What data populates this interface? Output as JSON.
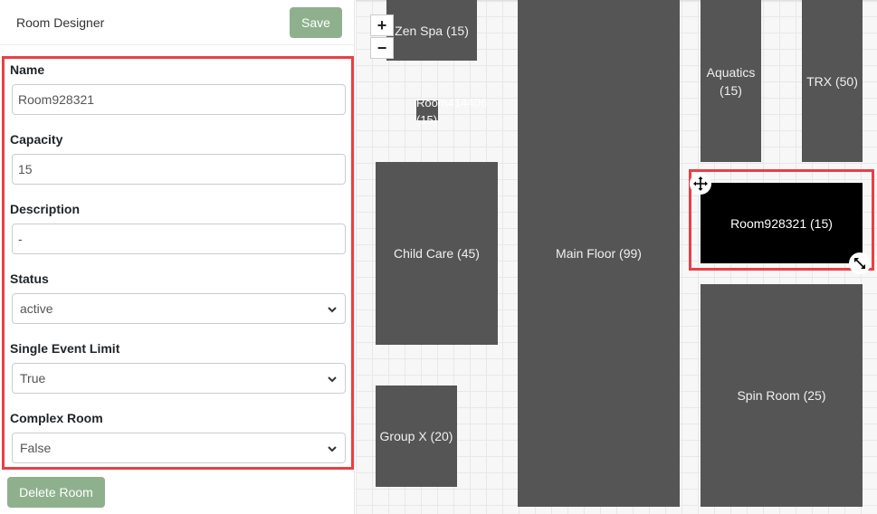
{
  "header": {
    "title": "Room Designer",
    "save_label": "Save"
  },
  "form": {
    "name": {
      "label": "Name",
      "value": "Room928321"
    },
    "capacity": {
      "label": "Capacity",
      "value": "15"
    },
    "description": {
      "label": "Description",
      "value": "-"
    },
    "status": {
      "label": "Status",
      "value": "active"
    },
    "single_event_limit": {
      "label": "Single Event Limit",
      "value": "True"
    },
    "complex_room": {
      "label": "Complex Room",
      "value": "False"
    }
  },
  "delete_label": "Delete Room",
  "zoom": {
    "in_label": "+",
    "out_label": "−"
  },
  "rooms": {
    "zen_spa": "Zen Spa (15)",
    "small_room": "Room414406 (15)",
    "child_care": "Child Care (45)",
    "group_x": "Group X (20)",
    "main_floor": "Main Floor (99)",
    "aquatics": "Aquatics (15)",
    "trx": "TRX (50)",
    "selected_room": "Room928321 (15)",
    "spin_room": "Spin Room (25)"
  },
  "colors": {
    "accent_green": "#8fb08d",
    "highlight_red": "#e84046",
    "room_fill": "#555555",
    "selected_fill": "#000000"
  }
}
